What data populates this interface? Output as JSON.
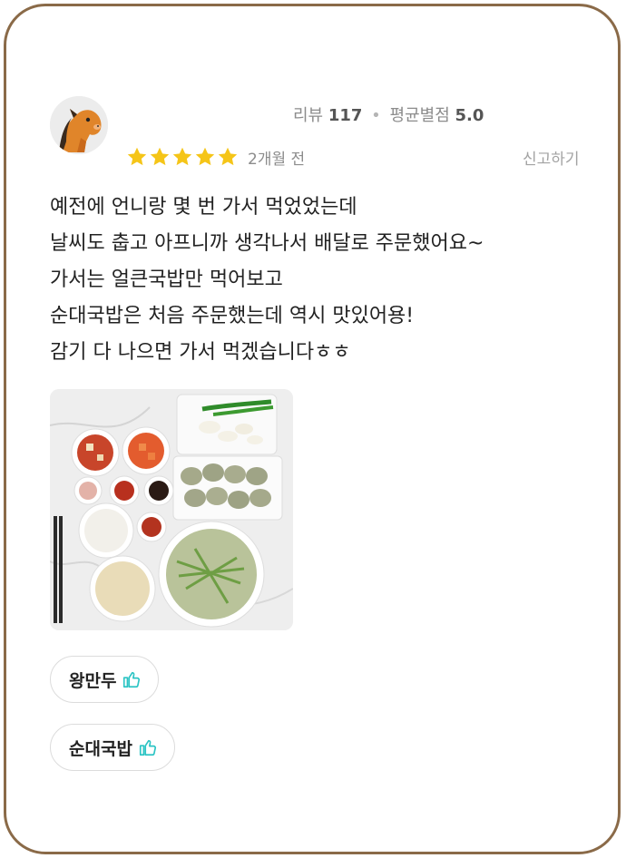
{
  "review": {
    "meta": {
      "review_label": "리뷰",
      "review_count": "117",
      "separator": "•",
      "avg_label": "평균별점",
      "avg_value": "5.0"
    },
    "rating": 5,
    "date": "2개월 전",
    "report_label": "신고하기",
    "lines": [
      "예전에 언니랑 몇 번 가서 먹었었는데",
      "날씨도 춥고 아프니까 생각나서 배달로 주문했어요~",
      "가서는 얼큰국밥만 먹어보고",
      "순대국밥은 처음 주문했는데 역시 맛있어용!",
      "감기 다 나으면 가서 먹겠습니다ㅎㅎ"
    ],
    "tags": [
      {
        "label": "왕만두",
        "icon": "thumbs-up-icon"
      },
      {
        "label": "순대국밥",
        "icon": "thumbs-up-icon"
      }
    ]
  },
  "colors": {
    "star": "#f5c518",
    "thumb": "#2bc4c4",
    "border": "#8a6a48"
  }
}
